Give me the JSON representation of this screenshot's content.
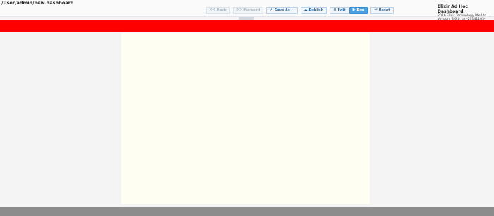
{
  "header": {
    "path": "/User/admin/new.dashboard"
  },
  "toolbar": {
    "back": {
      "label": "Back",
      "icon": "double-left-arrow-icon",
      "enabled": false
    },
    "forward": {
      "label": "Forward",
      "icon": "double-right-arrow-icon",
      "enabled": false
    },
    "save_as": {
      "label": "Save As...",
      "icon": "external-save-icon"
    },
    "publish": {
      "label": "Publish",
      "icon": "cloud-upload-icon"
    },
    "edit": {
      "label": "Edit",
      "icon": "list-icon"
    },
    "run": {
      "label": "Run",
      "icon": "play-icon",
      "active": true
    },
    "reset": {
      "label": "Reset",
      "icon": "reset-arrow-icon"
    }
  },
  "brand": {
    "title": "Elixir Ad Hoc Dashboard",
    "company": "2016 Elixir Technology Pte Ltd",
    "version": "Version: 3.6.0_jan-20141105-093040"
  },
  "colors": {
    "banner": "#ff0000",
    "canvas": "#fefff2",
    "footer": "#8c8c8c",
    "run_active": "#4a9fe0"
  }
}
